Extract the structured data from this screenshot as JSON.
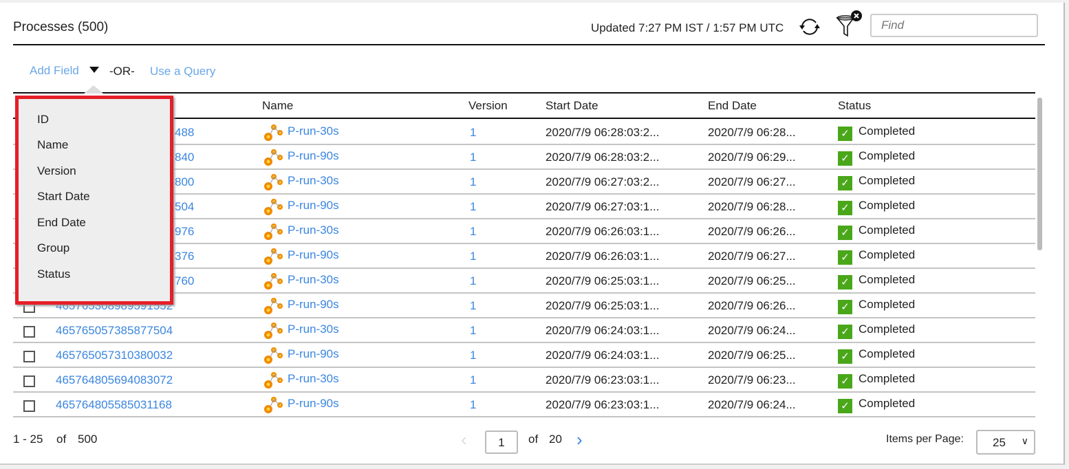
{
  "header": {
    "title": "Processes (500)",
    "updated": "Updated 7:27 PM IST / 1:57 PM UTC",
    "find_placeholder": "Find"
  },
  "query": {
    "add_field": "Add Field",
    "or": "-OR-",
    "use_query": "Use a Query"
  },
  "columns": [
    "ID",
    "Name",
    "Version",
    "Start Date",
    "End Date",
    "Status"
  ],
  "field_menu": [
    "ID",
    "Name",
    "Version",
    "Start Date",
    "End Date",
    "Group",
    "Status"
  ],
  "rows": [
    {
      "id": "488",
      "name": "P-run-30s",
      "version": "1",
      "start": "2020/7/9 06:28:03:2...",
      "end": "2020/7/9 06:28...",
      "status": "Completed"
    },
    {
      "id": "840",
      "name": "P-run-90s",
      "version": "1",
      "start": "2020/7/9 06:28:03:2...",
      "end": "2020/7/9 06:29...",
      "status": "Completed"
    },
    {
      "id": "800",
      "name": "P-run-30s",
      "version": "1",
      "start": "2020/7/9 06:27:03:2...",
      "end": "2020/7/9 06:27...",
      "status": "Completed"
    },
    {
      "id": "504",
      "name": "P-run-90s",
      "version": "1",
      "start": "2020/7/9 06:27:03:1...",
      "end": "2020/7/9 06:28...",
      "status": "Completed"
    },
    {
      "id": "976",
      "name": "P-run-30s",
      "version": "1",
      "start": "2020/7/9 06:26:03:1...",
      "end": "2020/7/9 06:26...",
      "status": "Completed"
    },
    {
      "id": "376",
      "name": "P-run-90s",
      "version": "1",
      "start": "2020/7/9 06:26:03:1...",
      "end": "2020/7/9 06:27...",
      "status": "Completed"
    },
    {
      "id": "760",
      "name": "P-run-30s",
      "version": "1",
      "start": "2020/7/9 06:25:03:1...",
      "end": "2020/7/9 06:25...",
      "status": "Completed"
    },
    {
      "id": "465765308989591552",
      "name": "P-run-90s",
      "version": "1",
      "start": "2020/7/9 06:25:03:1...",
      "end": "2020/7/9 06:26...",
      "status": "Completed"
    },
    {
      "id": "465765057385877504",
      "name": "P-run-30s",
      "version": "1",
      "start": "2020/7/9 06:24:03:1...",
      "end": "2020/7/9 06:24...",
      "status": "Completed"
    },
    {
      "id": "465765057310380032",
      "name": "P-run-90s",
      "version": "1",
      "start": "2020/7/9 06:24:03:1...",
      "end": "2020/7/9 06:25...",
      "status": "Completed"
    },
    {
      "id": "465764805694083072",
      "name": "P-run-30s",
      "version": "1",
      "start": "2020/7/9 06:23:03:1...",
      "end": "2020/7/9 06:23...",
      "status": "Completed"
    },
    {
      "id": "465764805585031168",
      "name": "P-run-90s",
      "version": "1",
      "start": "2020/7/9 06:23:03:1...",
      "end": "2020/7/9 06:24...",
      "status": "Completed"
    }
  ],
  "pagination": {
    "range": "1 - 25",
    "of": "of",
    "total": "500",
    "page": "1",
    "page_of": "of",
    "pages": "20",
    "items_per_page_label": "Items per Page:",
    "items_per_page": "25"
  },
  "colors": {
    "link": "#3b86df",
    "status_ok": "#4aa71a",
    "highlight": "#e61e28"
  }
}
